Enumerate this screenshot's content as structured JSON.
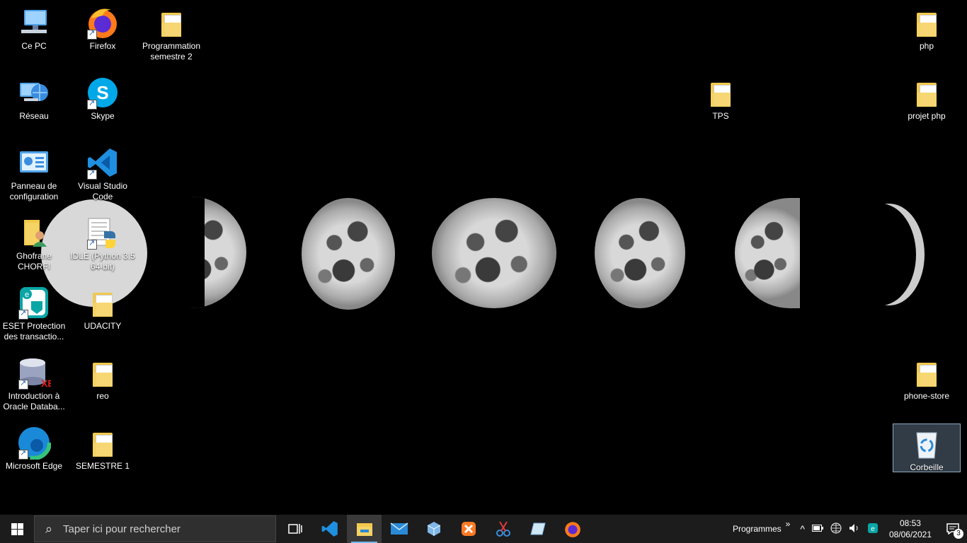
{
  "desktop_icons": {
    "ce_pc": "Ce PC",
    "firefox": "Firefox",
    "prog_sem2": "Programmation semestre 2",
    "php": "php",
    "reseau": "Réseau",
    "skype": "Skype",
    "tps": "TPS",
    "projet_php": "projet php",
    "panneau": "Panneau de configuration",
    "vscode": "Visual Studio Code",
    "ghofrane": "Ghofrane CHORFI",
    "idle": "IDLE (Python 3.5 64-bit)",
    "eset": "ESET Protection des transactio...",
    "udacity": "UDACITY",
    "oracle": "Introduction à Oracle Databa...",
    "reo": "reo",
    "phone_store": "phone-store",
    "edge": "Microsoft Edge",
    "semestre1": "SEMESTRE 1",
    "corbeille": "Corbeille"
  },
  "taskbar": {
    "search_placeholder": "Taper ici pour rechercher",
    "programs_label": "Programmes",
    "overflow_chevron": "»",
    "time": "08:53",
    "date": "08/06/2021",
    "notification_count": "3"
  },
  "colors": {
    "taskbar_bg": "#1c1c1c",
    "accent": "#76b9ed",
    "desktop_bg": "#000000"
  }
}
